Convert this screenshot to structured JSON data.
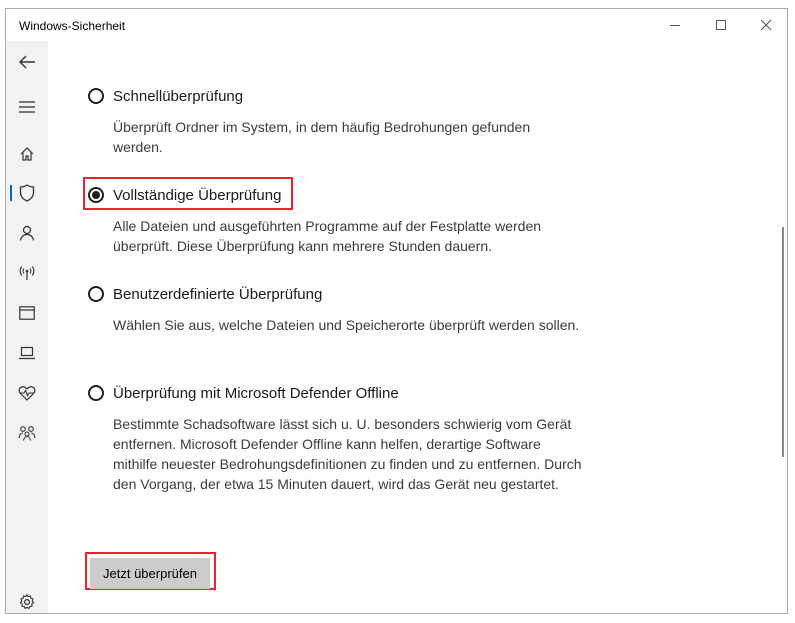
{
  "window": {
    "title": "Windows-Sicherheit"
  },
  "titlebar_icons": [
    "minimize-icon",
    "maximize-icon",
    "close-icon"
  ],
  "sidebar": {
    "items": [
      {
        "icon": "back-arrow-icon"
      },
      {
        "icon": "hamburger-menu-icon"
      },
      {
        "icon": "home-icon"
      },
      {
        "icon": "shield-icon",
        "active": true
      },
      {
        "icon": "person-icon"
      },
      {
        "icon": "wireless-icon"
      },
      {
        "icon": "app-browser-icon"
      },
      {
        "icon": "laptop-icon"
      },
      {
        "icon": "heart-pulse-icon"
      },
      {
        "icon": "family-icon"
      },
      {
        "icon": "settings-gear-icon"
      }
    ]
  },
  "scan_options": [
    {
      "label": "Schnellüberprüfung",
      "description": "Überprüft Ordner im System, in dem häufig Bedrohungen gefunden werden.",
      "selected": false
    },
    {
      "label": "Vollständige Überprüfung",
      "description": "Alle Dateien und ausgeführten Programme auf der Festplatte werden überprüft. Diese Überprüfung kann mehrere Stunden dauern.",
      "selected": true
    },
    {
      "label": "Benutzerdefinierte Überprüfung",
      "description": "Wählen Sie aus, welche Dateien und Speicherorte überprüft werden sollen.",
      "selected": false
    },
    {
      "label": "Überprüfung mit Microsoft Defender Offline",
      "description": "Bestimmte Schadsoftware lässt sich u. U. besonders schwierig vom Gerät entfernen. Microsoft Defender Offline kann helfen, derartige Software mithilfe neuester Bedrohungsdefinitionen zu finden und zu entfernen. Durch den Vorgang, der etwa 15 Minuten dauert, wird das Gerät neu gestartet.",
      "selected": false
    }
  ],
  "actions": {
    "scan_now_label": "Jetzt überprüfen"
  },
  "colors": {
    "highlight": "#e8232b",
    "accent": "#0067c0",
    "sidebar_bg": "#f2f2f2",
    "button_bg": "#cccccc"
  }
}
